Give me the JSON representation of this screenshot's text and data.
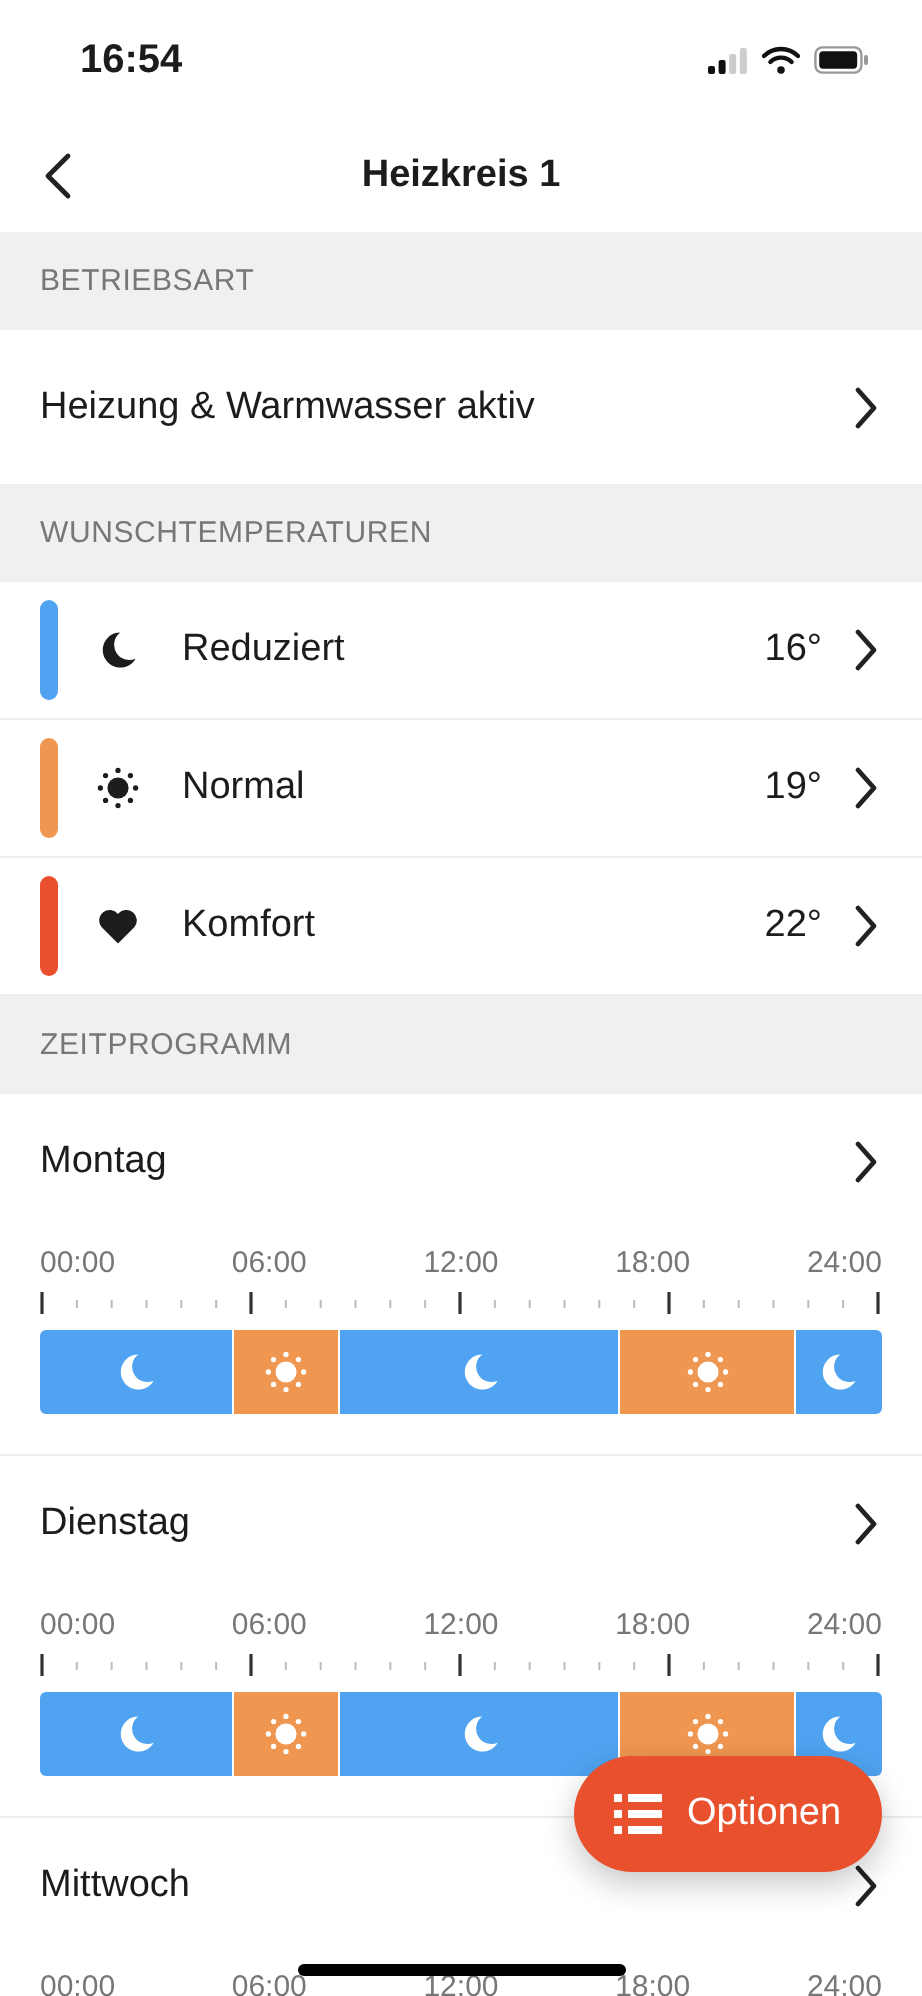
{
  "status_bar": {
    "time": "16:54"
  },
  "nav": {
    "title": "Heizkreis 1"
  },
  "operating_mode": {
    "header": "BETRIEBSART",
    "value": "Heizung & Warmwasser aktiv"
  },
  "temperatures": {
    "header": "WUNSCHTEMPERATUREN",
    "items": [
      {
        "kind": "moon",
        "label": "Reduziert",
        "value": "16°",
        "color": "#4fa3f0"
      },
      {
        "kind": "sun",
        "label": "Normal",
        "value": "19°",
        "color": "#ef9650"
      },
      {
        "kind": "heart",
        "label": "Komfort",
        "value": "22°",
        "color": "#e8502e"
      }
    ]
  },
  "schedule": {
    "header": "ZEITPROGRAMM",
    "days": [
      {
        "name": "Montag",
        "axis_labels": [
          "00:00",
          "06:00",
          "12:00",
          "18:00",
          "24:00"
        ],
        "segments": [
          {
            "kind": "reduced"
          },
          {
            "kind": "normal"
          },
          {
            "kind": "reduced"
          },
          {
            "kind": "normal"
          },
          {
            "kind": "reduced"
          }
        ]
      },
      {
        "name": "Dienstag",
        "axis_labels": [
          "00:00",
          "06:00",
          "12:00",
          "18:00",
          "24:00"
        ],
        "segments": [
          {
            "kind": "reduced"
          },
          {
            "kind": "normal"
          },
          {
            "kind": "reduced"
          },
          {
            "kind": "normal"
          },
          {
            "kind": "reduced"
          }
        ]
      },
      {
        "name": "Mittwoch",
        "axis_labels": [
          "00:00",
          "06:00",
          "12:00",
          "18:00",
          "24:00"
        ]
      }
    ]
  },
  "fab": {
    "label": "Optionen"
  }
}
